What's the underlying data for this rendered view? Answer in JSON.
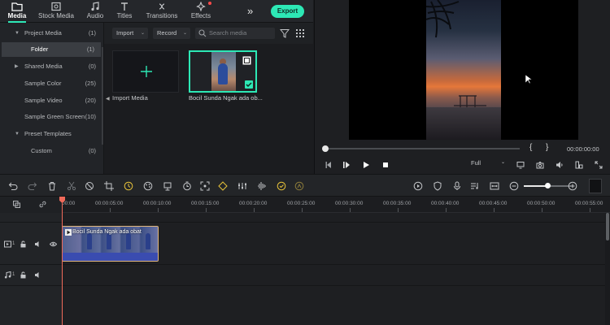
{
  "toolbar": {
    "tabs": [
      {
        "label": "Media",
        "icon": "folder-icon",
        "active": true
      },
      {
        "label": "Stock Media",
        "icon": "image-icon"
      },
      {
        "label": "Audio",
        "icon": "music-note-icon"
      },
      {
        "label": "Titles",
        "icon": "text-t-icon"
      },
      {
        "label": "Transitions",
        "icon": "transitions-icon"
      },
      {
        "label": "Effects",
        "icon": "sparkle-icon"
      }
    ],
    "more_label": "»",
    "export_label": "Export"
  },
  "library": {
    "items": [
      {
        "label": "Project Media",
        "count": "(1)",
        "expanded": true
      },
      {
        "label": "Folder",
        "count": "(1)",
        "selected": true
      },
      {
        "label": "Shared Media",
        "count": "(0)",
        "expanded": false
      },
      {
        "label": "Sample Color",
        "count": "(25)"
      },
      {
        "label": "Sample Video",
        "count": "(20)"
      },
      {
        "label": "Sample Green Screen",
        "count": "(10)"
      },
      {
        "label": "Preset Templates",
        "count": "",
        "expanded": true
      },
      {
        "label": "Custom",
        "count": "(0)"
      }
    ]
  },
  "media": {
    "import_dropdown": "Import",
    "record_dropdown": "Record",
    "search_placeholder": "Search media",
    "import_tile_label": "Import Media",
    "clip_label": "Bocil Sunda Ngak ada ob..."
  },
  "preview": {
    "timecode": "00:00:00:00",
    "mark_in": "{",
    "mark_out": "}",
    "quality": "Full"
  },
  "timeline": {
    "ruler_labels": [
      "00:00",
      "00:00:05:00",
      "00:00:10:00",
      "00:00:15:00",
      "00:00:20:00",
      "00:00:25:00",
      "00:00:30:00",
      "00:00:35:00",
      "00:00:40:00",
      "00:00:45:00",
      "00:00:50:00",
      "00:00:55:00"
    ],
    "video_clip_title": "Bocil Sunda Ngak ada obat",
    "video_track_num": "1",
    "audio_track_num": "1"
  },
  "colors": {
    "accent": "#2de8b5",
    "playhead": "#f06a5a",
    "clip_border": "#e0b67a"
  }
}
